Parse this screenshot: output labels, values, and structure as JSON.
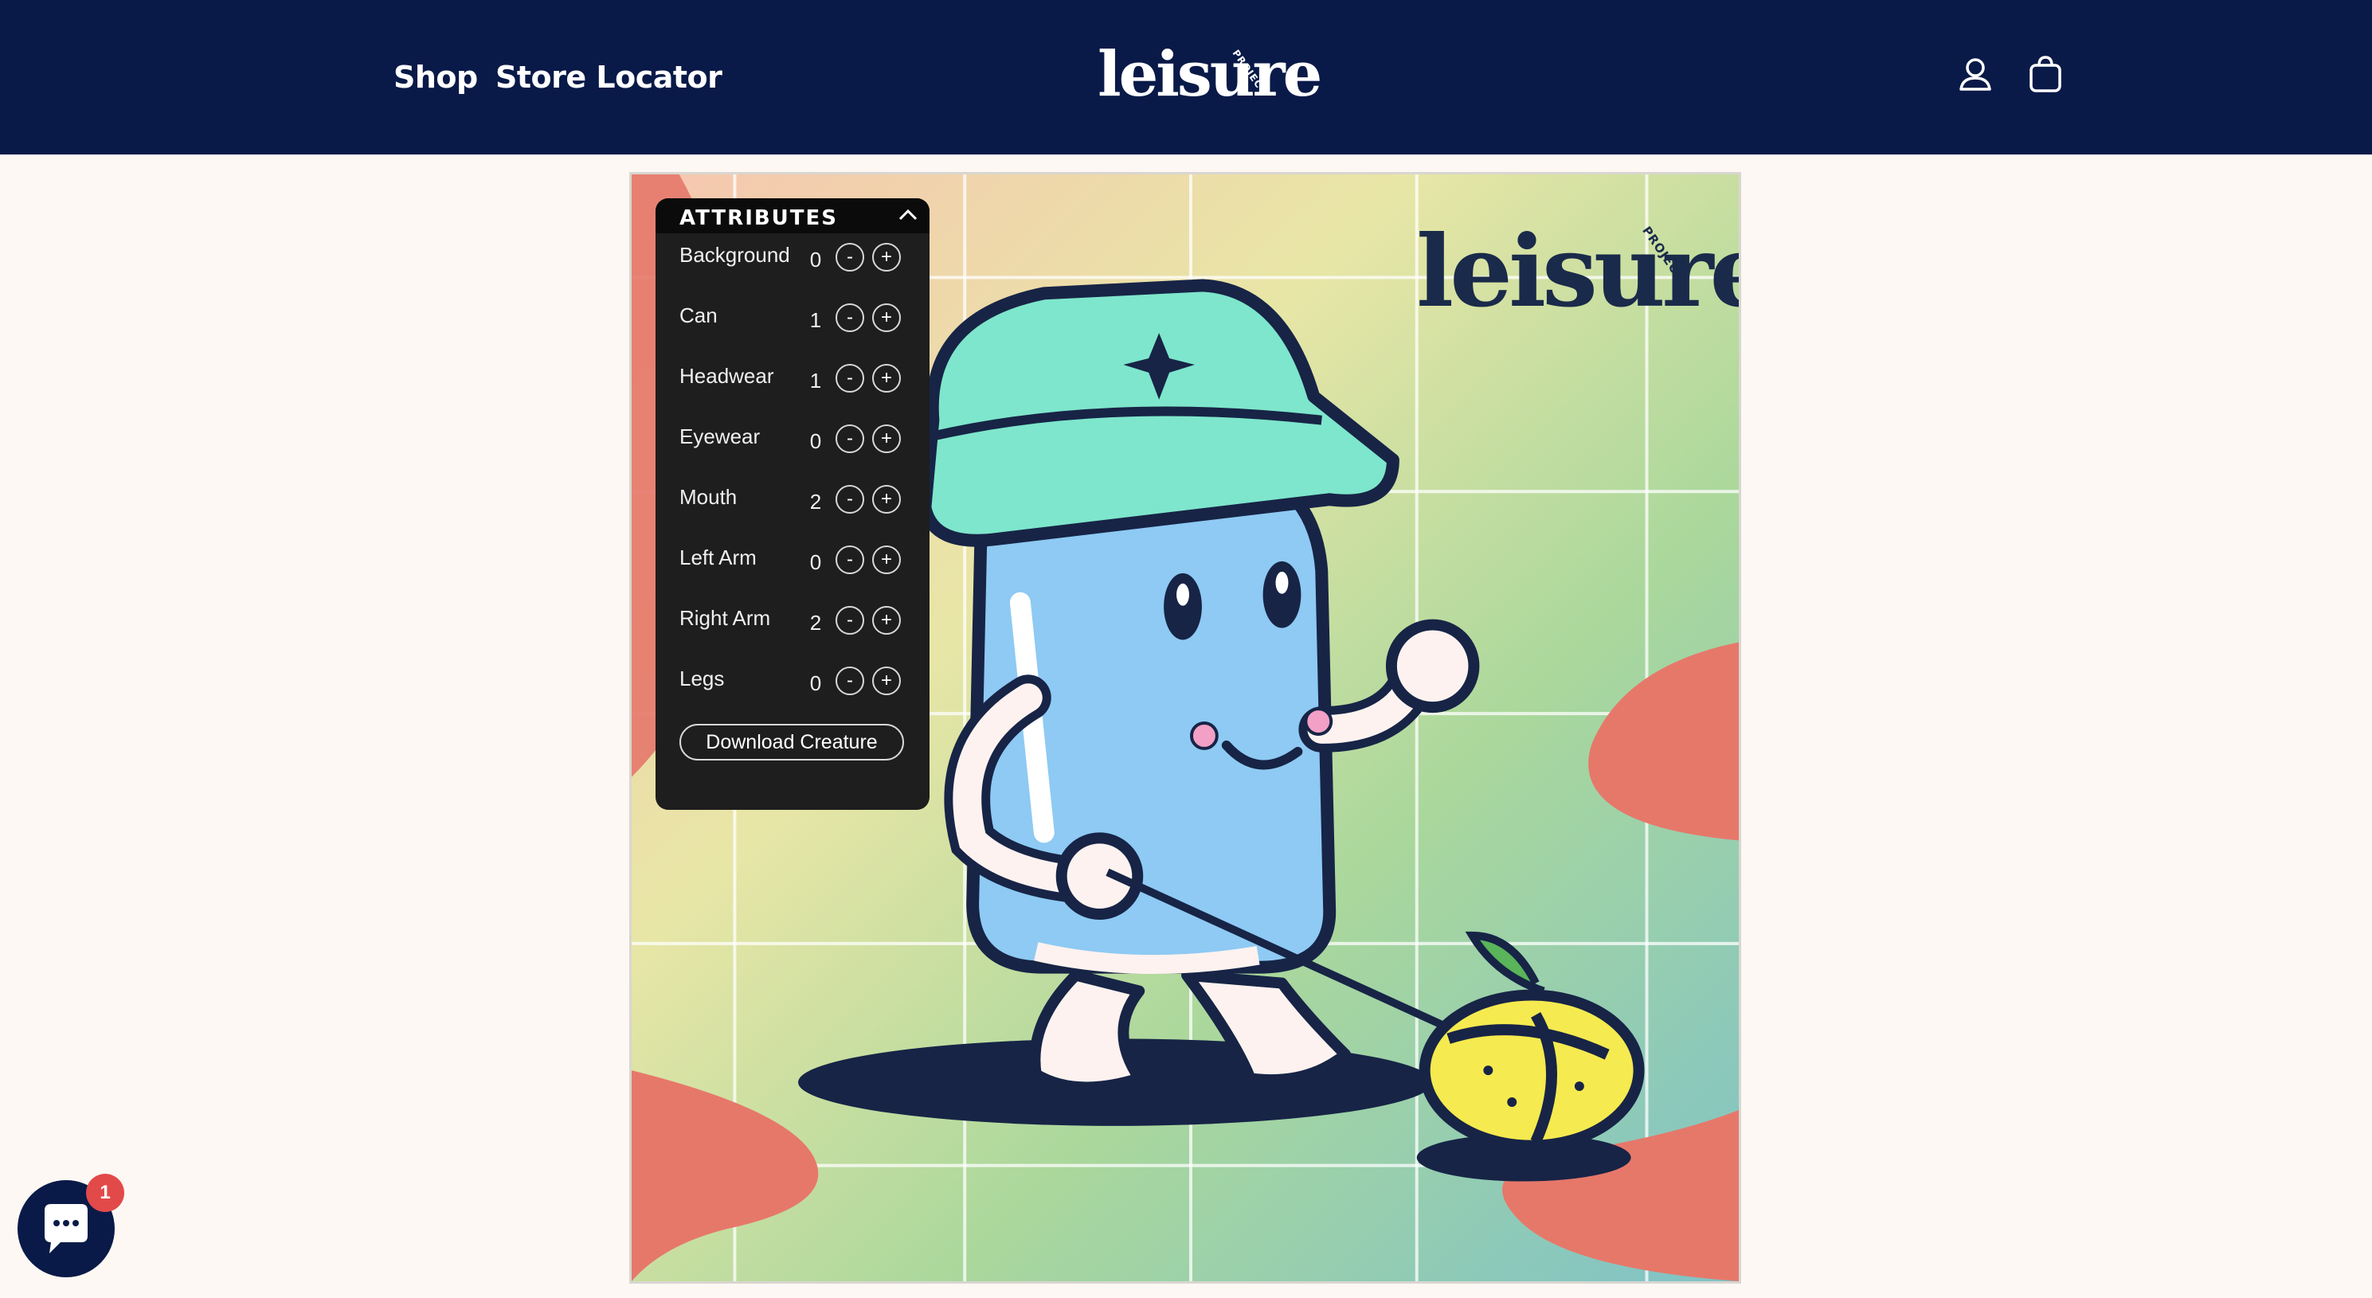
{
  "header": {
    "nav": [
      {
        "label": "Shop"
      },
      {
        "label": "Store Locator"
      }
    ],
    "logo": {
      "text": "leisure",
      "sub": "PROJECT"
    },
    "icons": [
      "account-icon",
      "cart-icon"
    ]
  },
  "artwork": {
    "logo": {
      "text": "leisure",
      "sub": "PROJECT"
    }
  },
  "attributes": {
    "title": "ATTRIBUTES",
    "rows": [
      {
        "label": "Background",
        "value": "0",
        "minus": "-",
        "plus": "+"
      },
      {
        "label": "Can",
        "value": "1",
        "minus": "-",
        "plus": "+"
      },
      {
        "label": "Headwear",
        "value": "1",
        "minus": "-",
        "plus": "+"
      },
      {
        "label": "Eyewear",
        "value": "0",
        "minus": "-",
        "plus": "+"
      },
      {
        "label": "Mouth",
        "value": "2",
        "minus": "-",
        "plus": "+"
      },
      {
        "label": "Left Arm",
        "value": "0",
        "minus": "-",
        "plus": "+"
      },
      {
        "label": "Right Arm",
        "value": "2",
        "minus": "-",
        "plus": "+"
      },
      {
        "label": "Legs",
        "value": "0",
        "minus": "-",
        "plus": "+"
      }
    ],
    "download_label": "Download Creature"
  },
  "chat": {
    "badge": "1"
  },
  "colors": {
    "header_bg": "#091a48",
    "page_bg": "#fdf8f3",
    "panel_bg": "#1e1e1e",
    "badge": "#e24a4a"
  }
}
